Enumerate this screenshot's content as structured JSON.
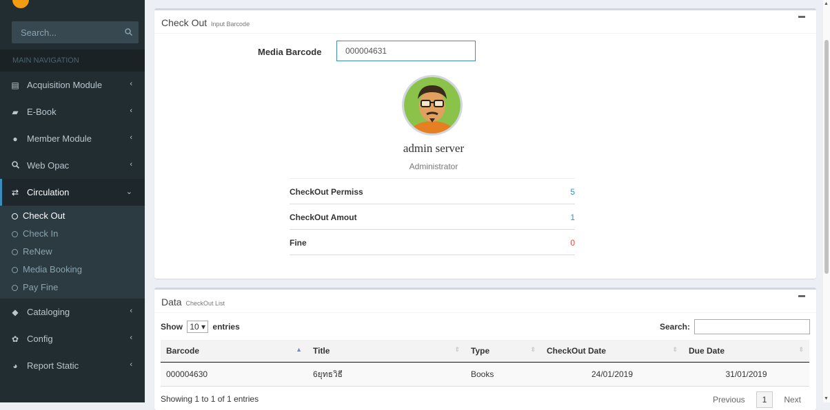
{
  "sidebar": {
    "search_placeholder": "Search...",
    "search_icon": "search-icon",
    "nav_header": "MAIN NAVIGATION",
    "items": [
      {
        "label": "Acquisition Module",
        "icon": "document-icon"
      },
      {
        "label": "E-Book",
        "icon": "book-icon"
      },
      {
        "label": "Member Module",
        "icon": "user-icon"
      },
      {
        "label": "Web Opac",
        "icon": "search-icon"
      },
      {
        "label": "Circulation",
        "icon": "exchange-icon"
      },
      {
        "label": "Cataloging",
        "icon": "tag-icon"
      },
      {
        "label": "Config",
        "icon": "gear-icon"
      },
      {
        "label": "Report Static",
        "icon": "pie-chart-icon"
      }
    ],
    "sub_items": [
      "Check Out",
      "Check In",
      "ReNew",
      "Media Booking",
      "Pay Fine"
    ]
  },
  "checkout_box": {
    "title": "Check Out",
    "subtitle": "Input Barcode",
    "barcode_label": "Media Barcode",
    "barcode_value": "000004631",
    "user_name": "admin server",
    "user_role": "Administrator",
    "stats": [
      {
        "label": "CheckOut Permiss",
        "value": "5"
      },
      {
        "label": "CheckOut Amout",
        "value": "1"
      },
      {
        "label": "Fine",
        "value": "0"
      }
    ]
  },
  "data_box": {
    "title": "Data",
    "subtitle": "CheckOut List",
    "show_label": "Show",
    "show_value": "10",
    "entries_label": "entries",
    "search_label": "Search:",
    "columns": [
      "Barcode",
      "Title",
      "Type",
      "CheckOut Date",
      "Due Date"
    ],
    "rows": [
      [
        "000004630",
        "6ยุทธวิธี",
        "Books",
        "24/01/2019",
        "31/01/2019"
      ]
    ],
    "info": "Showing 1 to 1 of 1 entries",
    "prev_label": "Previous",
    "page": "1",
    "next_label": "Next"
  },
  "colors": {
    "accent": "#3c8dbc",
    "sidebar": "#222d32",
    "danger": "#dd4b39"
  }
}
